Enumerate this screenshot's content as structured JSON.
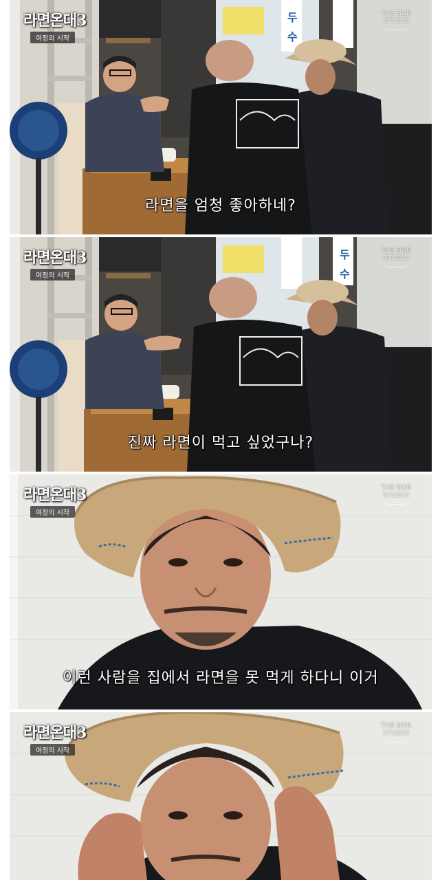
{
  "logo": {
    "title": "라면온대3",
    "subtitle": "여정의 시작"
  },
  "watermark": {
    "line1": "THE BOB",
    "line2": "STUDIO"
  },
  "panels": [
    {
      "subtitle": "라면을 엄청 좋아하네?"
    },
    {
      "subtitle": "진짜 라면이 먹고 싶었구나?"
    },
    {
      "subtitle": "이런 사람을 집에서 라면을 못 먹게 하다니 이거"
    },
    {
      "subtitle": ""
    }
  ],
  "signage": {
    "text": "두수"
  }
}
